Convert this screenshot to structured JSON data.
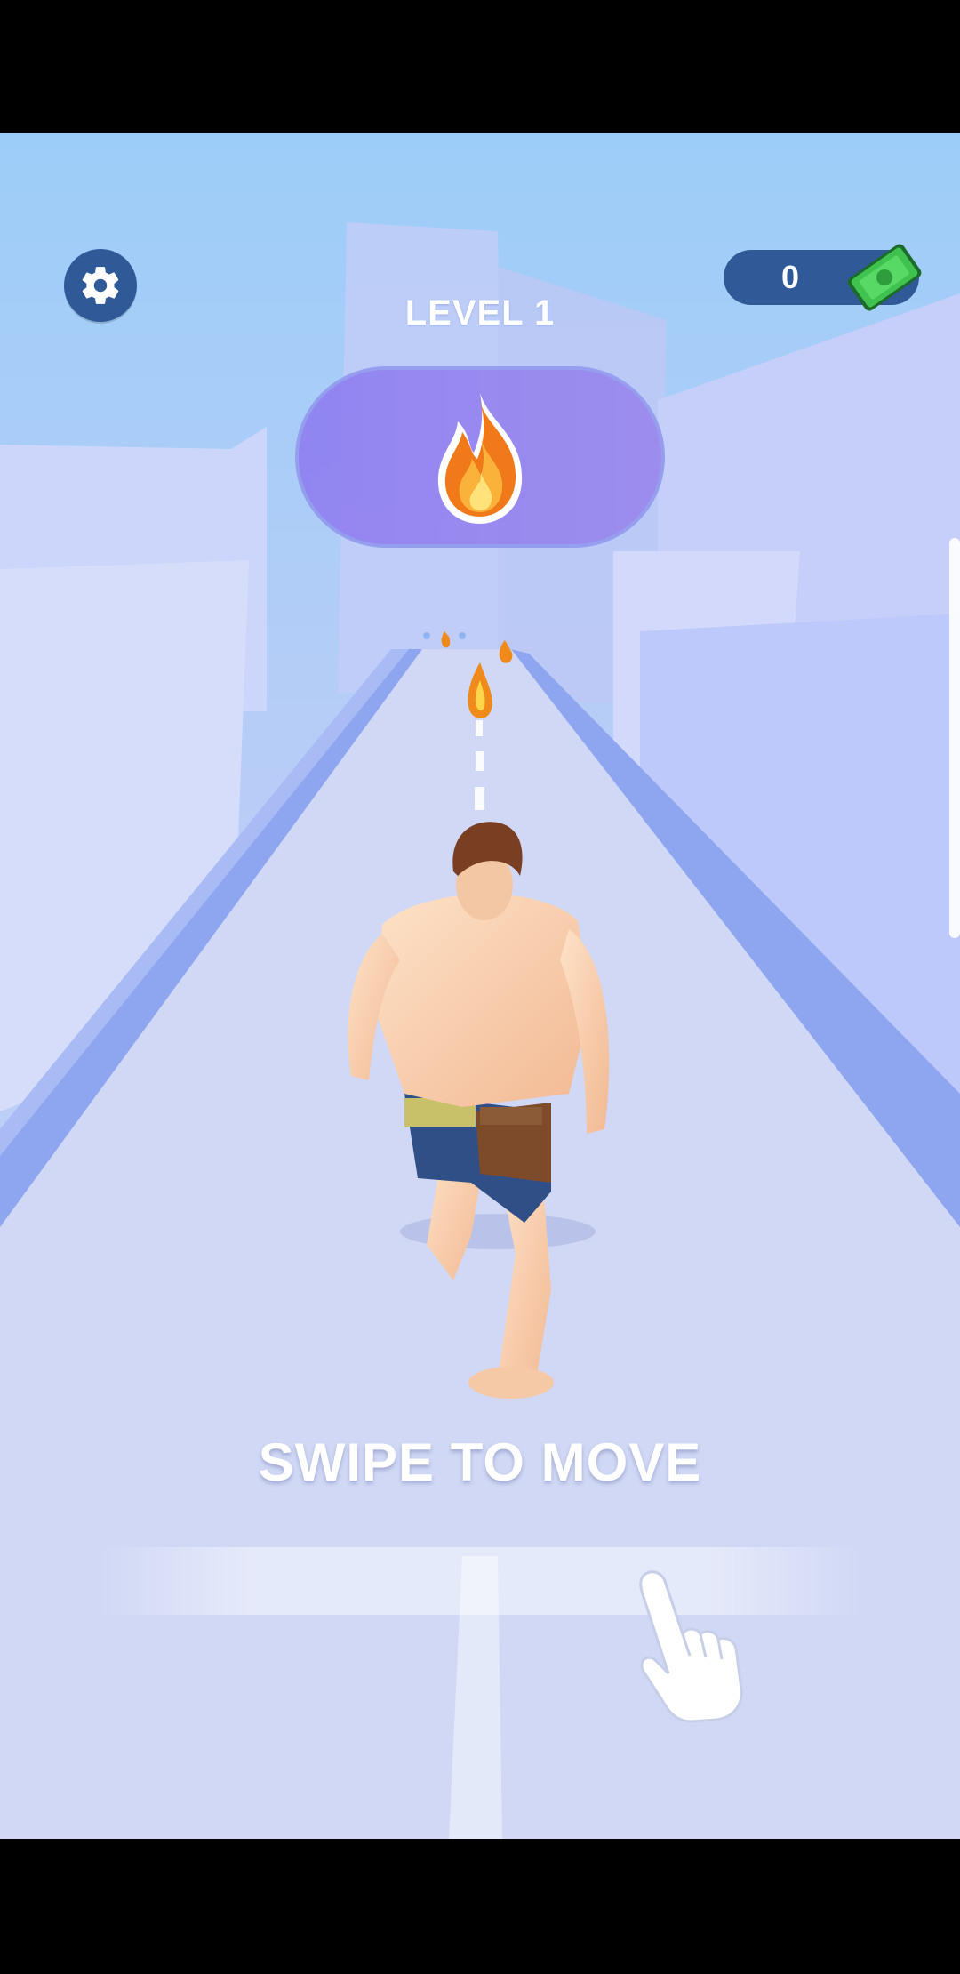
{
  "hud": {
    "settings_icon": "gear-icon",
    "money": "0",
    "money_icon": "cash-icon",
    "level_label": "LEVEL 1",
    "power_icon": "fire-icon"
  },
  "tutorial": {
    "hint": "SWIPE TO MOVE",
    "hand_icon": "pointing-hand-icon"
  },
  "colors": {
    "hud_bg": "#2f5a97",
    "sky": "#9ccdf8",
    "track": "#d0d8f5",
    "rail": "#8ea6ef",
    "pill": "#8e7cf0"
  }
}
